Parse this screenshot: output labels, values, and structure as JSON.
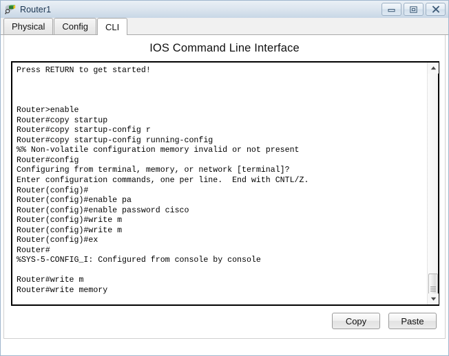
{
  "window": {
    "title": "Router1",
    "icon": "router-icon",
    "controls": [
      {
        "name": "minimize-button",
        "icon": "minimize-icon",
        "label": "Minimize"
      },
      {
        "name": "maximize-button",
        "icon": "maximize-icon",
        "label": "Maximize"
      },
      {
        "name": "close-button",
        "icon": "close-icon",
        "label": "Close"
      }
    ]
  },
  "tabs": [
    {
      "label": "Physical",
      "active": false
    },
    {
      "label": "Config",
      "active": false
    },
    {
      "label": "CLI",
      "active": true
    }
  ],
  "header": {
    "title": "IOS Command Line Interface"
  },
  "terminal": {
    "lines": [
      "Press RETURN to get started!",
      "",
      "",
      "",
      "Router>enable",
      "Router#copy startup",
      "Router#copy startup-config r",
      "Router#copy startup-config running-config",
      "%% Non-volatile configuration memory invalid or not present",
      "Router#config",
      "Configuring from terminal, memory, or network [terminal]?",
      "Enter configuration commands, one per line.  End with CNTL/Z.",
      "Router(config)#",
      "Router(config)#enable pa",
      "Router(config)#enable password cisco",
      "Router(config)#write m",
      "Router(config)#write m",
      "Router(config)#ex",
      "Router#",
      "%SYS-5-CONFIG_I: Configured from console by console",
      "",
      "Router#write m",
      "Router#write memory"
    ],
    "text": "Press RETURN to get started!\n\n\n\nRouter>enable\nRouter#copy startup\nRouter#copy startup-config r\nRouter#copy startup-config running-config\n%% Non-volatile configuration memory invalid or not present\nRouter#config\nConfiguring from terminal, memory, or network [terminal]?\nEnter configuration commands, one per line.  End with CNTL/Z.\nRouter(config)#\nRouter(config)#enable pa\nRouter(config)#enable password cisco\nRouter(config)#write m\nRouter(config)#write m\nRouter(config)#ex\nRouter#\n%SYS-5-CONFIG_I: Configured from console by console\n\nRouter#write m\nRouter#write memory"
  },
  "scrollbar": {
    "up_arrow": "scroll-up-arrow-icon",
    "down_arrow": "scroll-down-arrow-icon",
    "orientation": "vertical"
  },
  "buttons": {
    "copy_label": "Copy",
    "paste_label": "Paste"
  },
  "colors": {
    "titlebar_top": "#eaf0f6",
    "titlebar_bottom": "#c8d7e6",
    "frame_border": "#9fb6cd",
    "terminal_bg": "#ffffff",
    "terminal_fg": "#000000",
    "tab_active_bg": "#ffffff",
    "tab_inactive_bg": "#e4e4e4"
  }
}
